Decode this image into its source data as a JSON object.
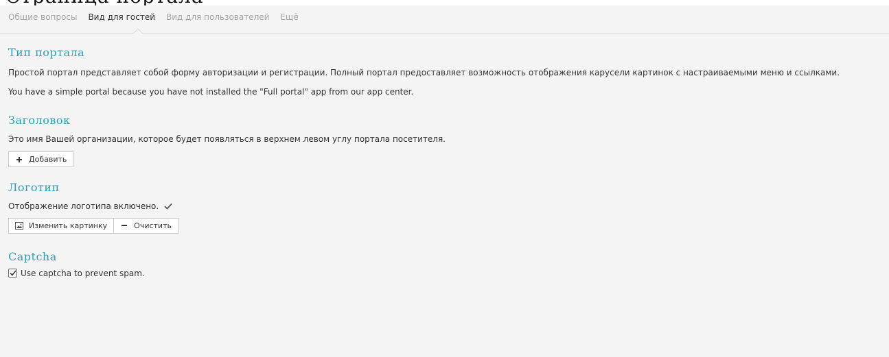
{
  "top_cut_text": "Страница портала",
  "tabs": [
    {
      "label": "Общие вопросы",
      "active": false
    },
    {
      "label": "Вид для гостей",
      "active": true
    },
    {
      "label": "Вид для пользователей",
      "active": false
    },
    {
      "label": "Ещё",
      "active": false
    }
  ],
  "sections": {
    "portal_type": {
      "title": "Тип портала",
      "description": "Простой портал представляет собой форму авторизации и регистрации. Полный портал предоставляет возможность отображения карусели картинок с настраиваемыми меню и ссылками.",
      "note": "You have a simple portal because you have not installed the \"Full portal\" app from our app center."
    },
    "heading": {
      "title": "Заголовок",
      "description": "Это имя Вашей организации, которое будет появляться в верхнем левом углу портала посетителя.",
      "add_button": "Добавить"
    },
    "logo": {
      "title": "Логотип",
      "status": "Отображение логотипа включено.",
      "change_button": "Изменить картинку",
      "clear_button": "Очистить"
    },
    "captcha": {
      "title": "Captcha",
      "checkbox_label": "Use captcha to prevent spam.",
      "checked": true
    }
  },
  "colors": {
    "accent": "#2ba0b5",
    "panel_bg": "#f4f4f4",
    "tab_inactive": "#a6a6a6"
  },
  "icons": [
    "plus-icon",
    "image-icon",
    "minus-icon",
    "checkmark-icon",
    "checkbox-checked-icon"
  ]
}
